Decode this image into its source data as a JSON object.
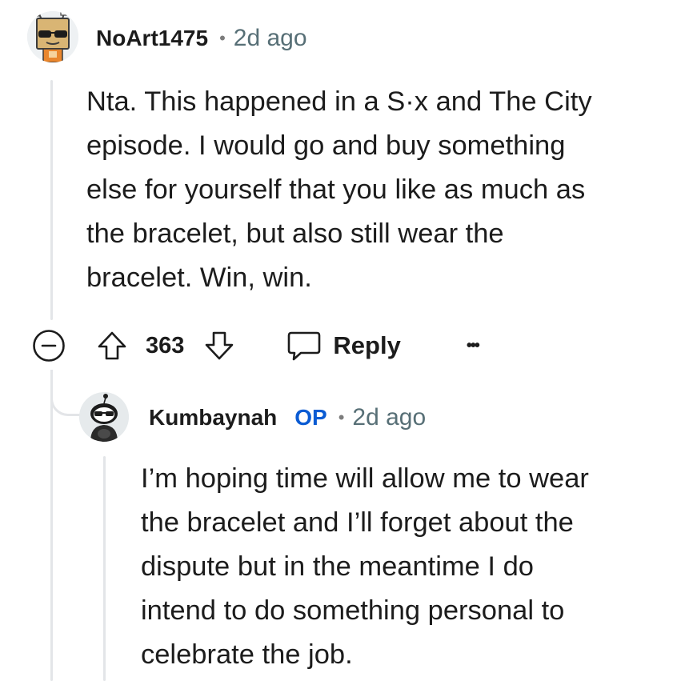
{
  "top_comment": {
    "username": "NoArt1475",
    "separator": "•",
    "time": "2d ago",
    "body_lines": [
      "Nta. This happened in a S·x and The City",
      "episode. I would go and buy something",
      "else for yourself that you like as much as",
      "the bracelet, but also still wear the",
      "bracelet. Win, win."
    ],
    "score": "363",
    "reply_label": "Reply",
    "more_label": "•••",
    "avatar_icon": "robot-avatar-icon"
  },
  "reply_comment": {
    "username": "Kumbaynah",
    "op_badge": "OP",
    "separator": "•",
    "time": "2d ago",
    "body_lines": [
      "I’m hoping time will allow me to wear",
      "the bracelet and I’ll forget about the",
      "dispute but in the meantime I do",
      "intend to do something personal to",
      "celebrate the job."
    ],
    "avatar_icon": "snoo-avatar-icon"
  },
  "colors": {
    "text": "#1c1c1c",
    "meta": "#576f76",
    "op": "#0a5bd3",
    "thread_line": "#e3e5e8"
  }
}
